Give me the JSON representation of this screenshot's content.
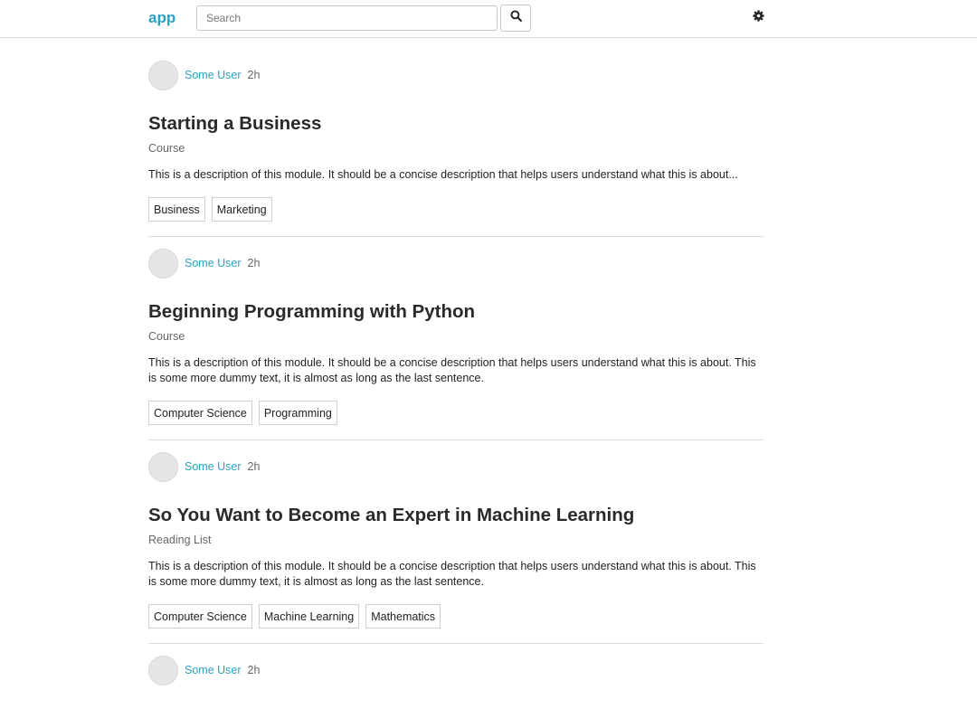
{
  "navbar": {
    "logo": "app",
    "search_placeholder": "Search",
    "search_icon": "search-icon",
    "settings_icon": "gear-icon"
  },
  "posts": [
    {
      "author": "Some User",
      "time": "2h",
      "title": "Starting a Business",
      "type": "Course",
      "description": "This is a description of this module. It should be a concise description that helps users understand what this is about...",
      "tags": [
        "Business",
        "Marketing"
      ]
    },
    {
      "author": "Some User",
      "time": "2h",
      "title": "Beginning Programming with Python",
      "type": "Course",
      "description": "This is a description of this module. It should be a concise description that helps users understand what this is about. This is some more dummy text, it is almost as long as the last sentence.",
      "tags": [
        "Computer Science",
        "Programming"
      ]
    },
    {
      "author": "Some User",
      "time": "2h",
      "title": "So You Want to Become an Expert in Machine Learning",
      "type": "Reading List",
      "description": "This is a description of this module. It should be a concise description that helps users understand what this is about. This is some more dummy text, it is almost as long as the last sentence.",
      "tags": [
        "Computer Science",
        "Machine Learning",
        "Mathematics"
      ]
    },
    {
      "author": "Some User",
      "time": "2h"
    }
  ],
  "colors": {
    "accent": "#29a3c2",
    "divider": "#dcdcdc"
  }
}
